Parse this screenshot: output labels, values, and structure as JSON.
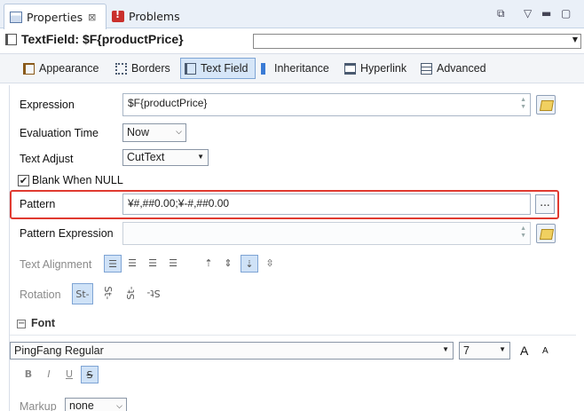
{
  "tabs": [
    {
      "label": "Properties",
      "close": "⊠"
    },
    {
      "label": "Problems"
    }
  ],
  "header": {
    "title": "TextField: $F{productPrice}"
  },
  "section_tabs": [
    {
      "label": "Appearance"
    },
    {
      "label": "Borders"
    },
    {
      "label": "Text Field"
    },
    {
      "label": "Inheritance"
    },
    {
      "label": "Hyperlink"
    },
    {
      "label": "Advanced"
    }
  ],
  "form": {
    "expression_label": "Expression",
    "expression_value": "$F{productPrice}",
    "eval_time_label": "Evaluation Time",
    "eval_time_value": "Now",
    "text_adjust_label": "Text Adjust",
    "text_adjust_value": "CutText",
    "blank_when_null_label": "Blank When NULL",
    "blank_when_null_checked": "✔",
    "pattern_label": "Pattern",
    "pattern_value": "¥#,##0.00;¥-#,##0.00",
    "pattern_btn": "...",
    "pattern_expression_label": "Pattern Expression",
    "pattern_expression_value": "",
    "text_alignment_label": "Text Alignment",
    "rotation_label": "Rotation"
  },
  "font": {
    "section_label": "Font",
    "collapse_glyph": "−",
    "family": "PingFang Regular",
    "size": "7",
    "grow_label": "A",
    "shrink_label": "A",
    "bold": "B",
    "italic": "I",
    "underline": "U",
    "strike": "S",
    "markup_label": "Markup",
    "markup_value": "none"
  },
  "colors": {
    "accent": "#7ea4d4",
    "highlight": "#e03a30"
  }
}
